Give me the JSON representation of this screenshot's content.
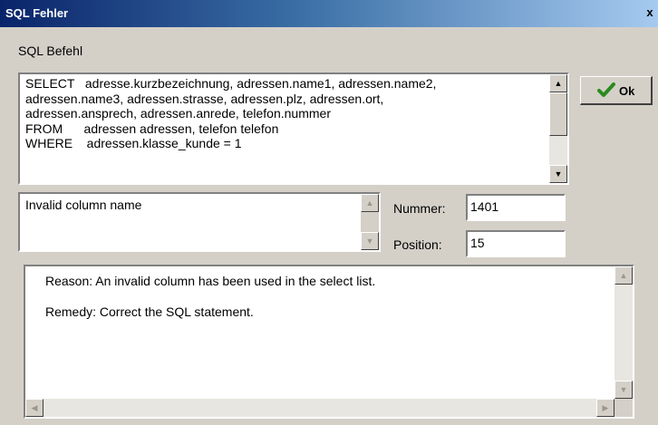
{
  "window": {
    "title": "SQL Fehler",
    "close_label": "x"
  },
  "sql_section": {
    "label": "SQL Befehl",
    "lines": [
      "SELECT   adresse.kurzbezeichnung, adressen.name1, adressen.name2,",
      "adressen.name3, adressen.strasse, adressen.plz, adressen.ort,",
      "adressen.ansprech, adressen.anrede, telefon.nummer",
      "FROM      adressen adressen, telefon telefon",
      "WHERE    adressen.klasse_kunde = 1"
    ]
  },
  "ok_button": {
    "label": "Ok",
    "icon": "checkmark-icon",
    "icon_color": "#2a8a1f"
  },
  "error": {
    "message": "Invalid column name",
    "nummer_label": "Nummer:",
    "nummer_value": "1401",
    "position_label": "Position:",
    "position_value": "15"
  },
  "details": {
    "reason": "Reason: An invalid column has been used in the select list.",
    "remedy": "Remedy: Correct the SQL statement."
  }
}
